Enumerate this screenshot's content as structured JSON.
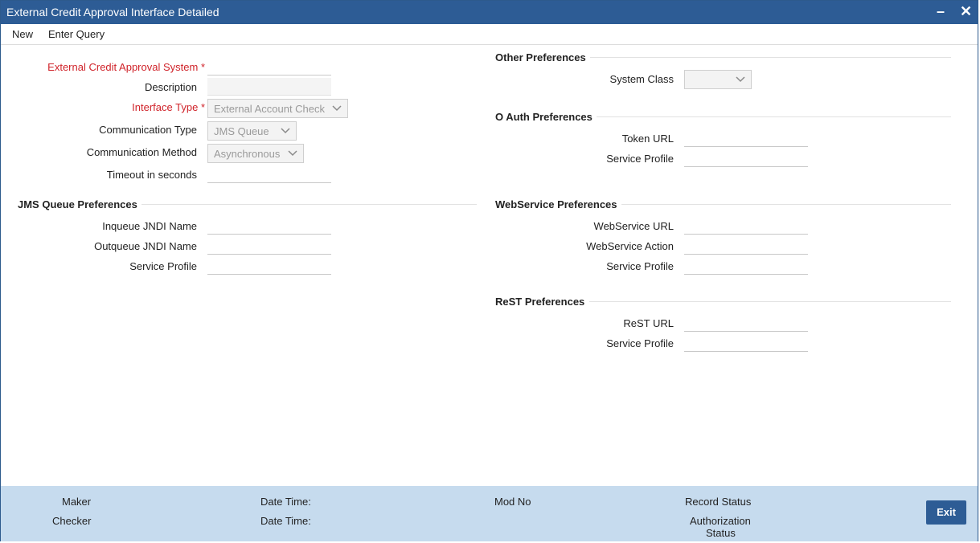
{
  "window": {
    "title": "External Credit Approval Interface Detailed",
    "minimize": "–",
    "close": "✕"
  },
  "menu": {
    "new": "New",
    "enter_query": "Enter Query"
  },
  "main": {
    "ext_system_label": "External Credit Approval System",
    "required_marker": "*",
    "description_label": "Description",
    "interface_type_label": "Interface Type",
    "interface_type_value": "External Account Check",
    "comm_type_label": "Communication Type",
    "comm_type_value": "JMS Queue",
    "comm_method_label": "Communication Method",
    "comm_method_value": "Asynchronous",
    "timeout_label": "Timeout in seconds"
  },
  "jms": {
    "title": "JMS Queue Preferences",
    "inqueue_label": "Inqueue JNDI Name",
    "outqueue_label": "Outqueue JNDI Name",
    "service_profile_label": "Service Profile"
  },
  "other": {
    "title": "Other Preferences",
    "system_class_label": "System Class"
  },
  "oauth": {
    "title": "O Auth Preferences",
    "token_url_label": "Token URL",
    "service_profile_label": "Service Profile"
  },
  "webservice": {
    "title": "WebService Preferences",
    "url_label": "WebService URL",
    "action_label": "WebService Action",
    "service_profile_label": "Service Profile"
  },
  "rest": {
    "title": "ReST Preferences",
    "url_label": "ReST URL",
    "service_profile_label": "Service Profile"
  },
  "footer": {
    "maker": "Maker",
    "checker": "Checker",
    "datetime1": "Date Time:",
    "datetime2": "Date Time:",
    "mod_no": "Mod No",
    "record_status": "Record Status",
    "authorization": "Authorization",
    "status": "Status",
    "exit": "Exit"
  }
}
